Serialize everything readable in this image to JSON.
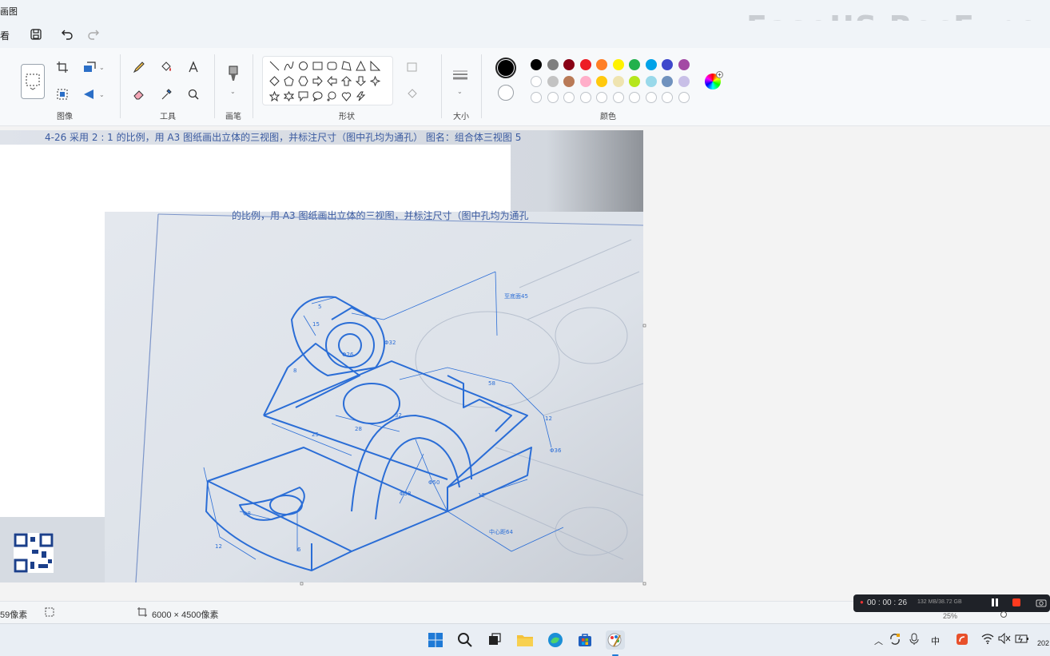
{
  "window": {
    "title": "画图",
    "watermark": "EaseUS RecExpe"
  },
  "menubar": {
    "file_label": "看"
  },
  "ribbon": {
    "groups": {
      "image": "图像",
      "tools": "工具",
      "brushes": "画笔",
      "shapes": "形状",
      "size": "大小",
      "colors": "颜色"
    },
    "palette_row1": [
      "#000000",
      "#7f7f7f",
      "#880015",
      "#ed1c24",
      "#ff7f27",
      "#fff200",
      "#22b14c",
      "#00a2e8",
      "#3f48cc",
      "#a349a4"
    ],
    "palette_row2": [
      "#ffffff",
      "#c3c3c3",
      "#b97a57",
      "#ffaec9",
      "#ffc90e",
      "#efe4b0",
      "#b5e61d",
      "#99d9ea",
      "#7092be",
      "#c8bfe7"
    ],
    "primary_color": "#000000",
    "secondary_color": "#ffffff"
  },
  "canvas": {
    "header_text": "4-26   采用 2 : 1 的比例，用 A3 图纸画出立体的三视图，并标注尺寸（图中孔均为通孔） 图名：组合体三视图 5",
    "header_text2": "的比例，用 A3 图纸画出立体的三视图，并标注尺寸（图中孔均为通孔",
    "dimensions": {
      "d1": "5",
      "d2": "15",
      "d3": "Φ32",
      "d4": "8",
      "d5": "至底面45",
      "d6": "58",
      "d7": "12",
      "d8": "Φ36",
      "d9": "Φ26",
      "d10": "Φ8",
      "d11": "12",
      "d12": "25",
      "d13": "Φ38",
      "d14": "Φ50",
      "d15": "12",
      "d16": "6",
      "d17": "32",
      "d18": "中心距64",
      "d19": "Φ20",
      "d20": "28"
    }
  },
  "statusbar": {
    "cursor_pos": "59像素",
    "image_size": "6000 × 4500像素",
    "zoom": "25%"
  },
  "recorder": {
    "time": "00 : 00 : 26",
    "size": "132 MB/38.72 GB"
  },
  "tray": {
    "ime": "中",
    "date": "202"
  }
}
